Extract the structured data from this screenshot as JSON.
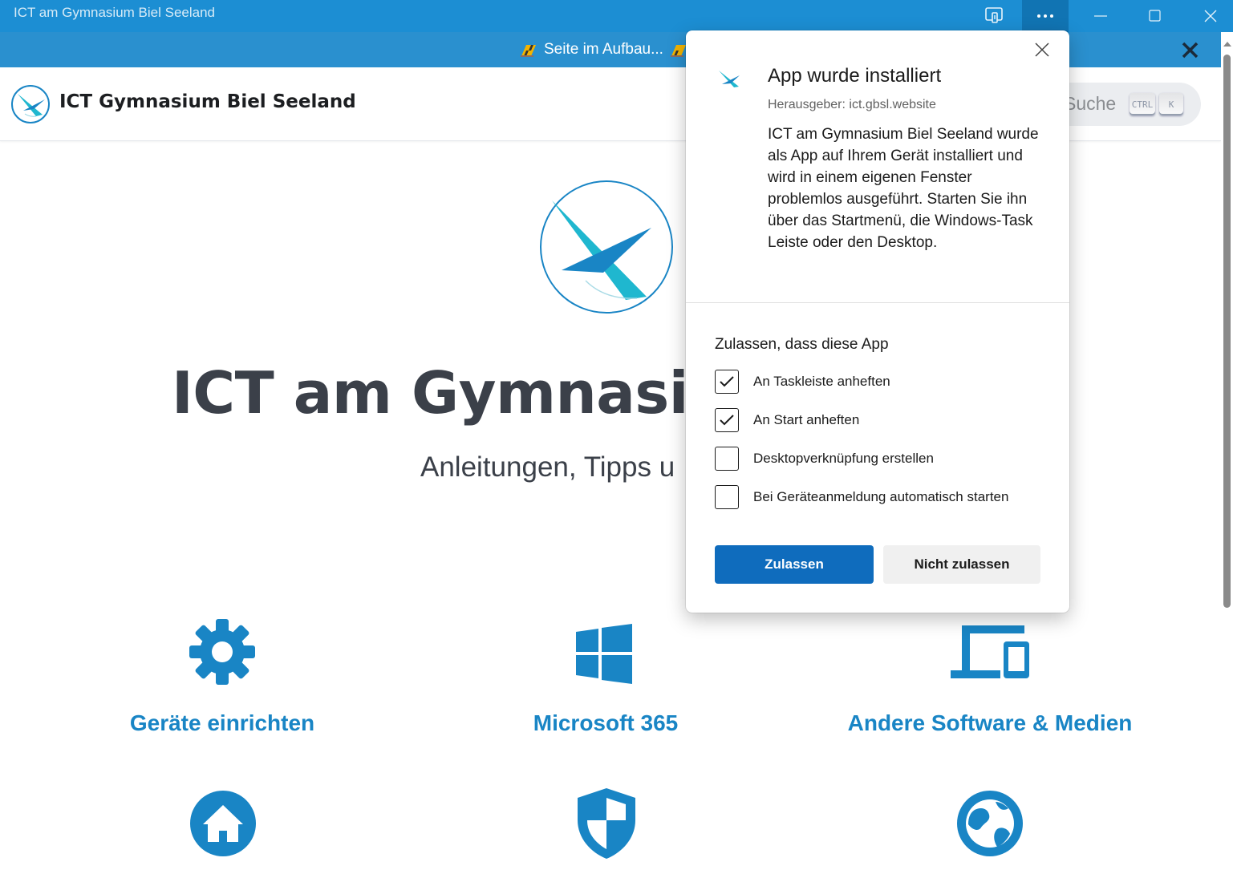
{
  "window": {
    "title": "ICT am Gymnasium Biel Seeland",
    "buttons": [
      "app-available-icon",
      "more-icon",
      "minimize-icon",
      "maximize-icon",
      "close-icon"
    ]
  },
  "announcement": {
    "text": "Seite im Aufbau..."
  },
  "navbar": {
    "brand": "ICT Gymnasium Biel Seeland",
    "search_placeholder": "Suche",
    "shortcut_keys": [
      "CTRL",
      "K"
    ]
  },
  "hero": {
    "title": "ICT am Gymnasium",
    "subtitle": "Anleitungen, Tipps u"
  },
  "features": [
    {
      "label": "Geräte einrichten",
      "icon": "gear-icon"
    },
    {
      "label": "Microsoft 365",
      "icon": "windows-icon"
    },
    {
      "label": "Andere Software & Medien",
      "icon": "devices-icon"
    },
    {
      "icon": "home-icon"
    },
    {
      "icon": "shield-icon"
    },
    {
      "icon": "globe-icon"
    }
  ],
  "dialog": {
    "title": "App wurde installiert",
    "publisher": "Herausgeber: ict.gbsl.website",
    "description": "ICT am Gymnasium Biel Seeland wurde als App auf Ihrem Gerät installiert und wird in einem eigenen Fenster problemlos ausgeführt. Starten Sie ihn über das Startmenü, die Windows-Task Leiste oder den Desktop.",
    "permissions_title": "Zulassen, dass diese App",
    "options": [
      {
        "label": "An Taskleiste anheften",
        "checked": true
      },
      {
        "label": "An Start anheften",
        "checked": true
      },
      {
        "label": "Desktopverknüpfung erstellen",
        "checked": false
      },
      {
        "label": "Bei Geräteanmeldung automatisch starten",
        "checked": false
      }
    ],
    "allow_label": "Zulassen",
    "deny_label": "Nicht zulassen"
  },
  "colors": {
    "titlebar": "#1c8ed3",
    "announcement": "#2a90cf",
    "accent": "#1985c5",
    "primary_button": "#0f6cbd"
  }
}
